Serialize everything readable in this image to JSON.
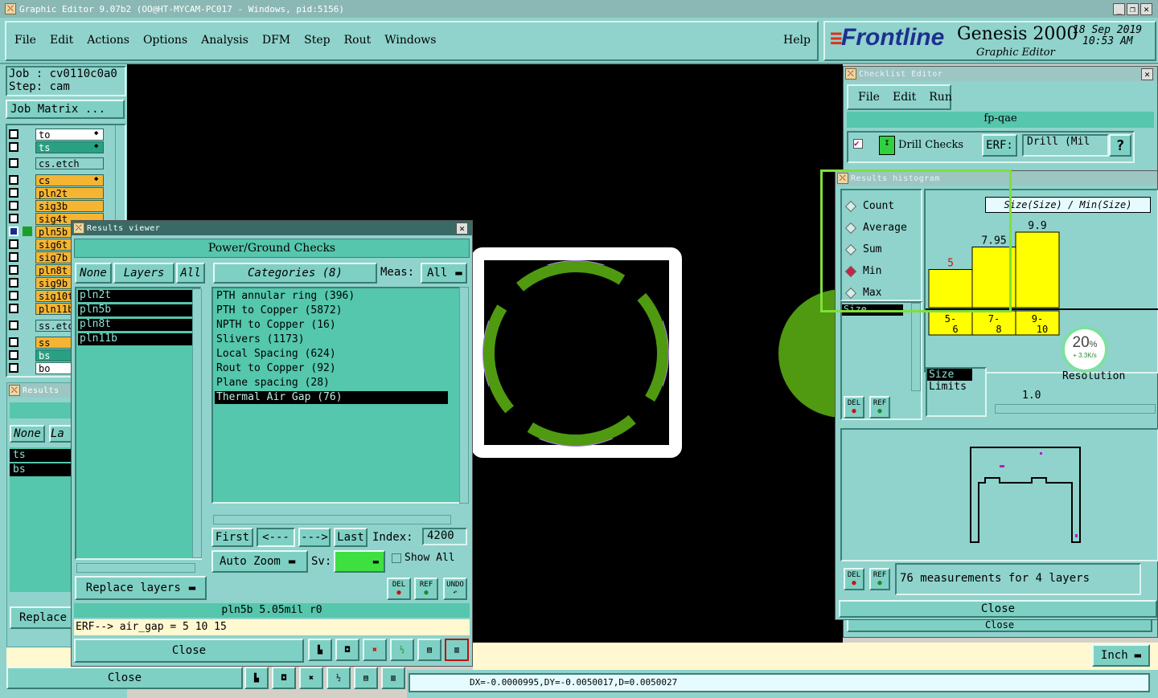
{
  "window": {
    "title": "Graphic Editor 9.07b2 (OO@HT-MYCAM-PC017 - Windows, pid:5156)"
  },
  "menu": {
    "items": [
      "File",
      "Edit",
      "Actions",
      "Options",
      "Analysis",
      "DFM",
      "Step",
      "Rout",
      "Windows"
    ],
    "help": "Help"
  },
  "brand": {
    "logo": "Frontline",
    "product": "Genesis 2000",
    "subtitle": "Graphic Editor",
    "date": "18 Sep 2019",
    "time": "10:53 AM"
  },
  "job": {
    "job": "Job : cv0110c0a0",
    "step": "Step: cam",
    "matrix_button": "Job Matrix ..."
  },
  "layers": [
    {
      "name": "to",
      "color": "#ffffff",
      "board": true
    },
    {
      "name": "ts",
      "color": "#2aa082",
      "board": true
    },
    {
      "name": "cs.etch",
      "color": "#8fd3cc",
      "board": false
    },
    {
      "name": "cs",
      "color": "#f5b432",
      "board": true
    },
    {
      "name": "pln2t",
      "color": "#f5b432",
      "board": false
    },
    {
      "name": "sig3b",
      "color": "#f5b432",
      "board": false
    },
    {
      "name": "sig4t",
      "color": "#f5b432",
      "board": false
    },
    {
      "name": "pln5b",
      "color": "#f5b432",
      "board": false
    },
    {
      "name": "sig6t",
      "color": "#f5b432",
      "board": false
    },
    {
      "name": "sig7b",
      "color": "#f5b432",
      "board": false
    },
    {
      "name": "pln8t",
      "color": "#f5b432",
      "board": false
    },
    {
      "name": "sig9b",
      "color": "#f5b432",
      "board": false
    },
    {
      "name": "sig10t",
      "color": "#f5b432",
      "board": false
    },
    {
      "name": "pln11b",
      "color": "#f5b432",
      "board": false
    },
    {
      "name": "ss.etch",
      "color": "#8fd3cc",
      "board": false
    },
    {
      "name": "ss",
      "color": "#f5b432",
      "board": false
    },
    {
      "name": "bs",
      "color": "#2aa082",
      "board": false
    },
    {
      "name": "bo",
      "color": "#ffffff",
      "board": false
    }
  ],
  "results_back": {
    "title": "Results",
    "none": "None",
    "layers": "La",
    "items": [
      "ts",
      "bs"
    ],
    "replace": "Replace",
    "close": "Close"
  },
  "results_viewer": {
    "title": "Results viewer",
    "header": "Power/Ground Checks",
    "none": "None",
    "layers": "Layers",
    "all": "All",
    "layer_items": [
      "pln2t",
      "pln5b",
      "pln8t",
      "pln11b"
    ],
    "categories_label": "Categories (8)",
    "meas_label": "Meas:",
    "meas_value": "All",
    "categories": [
      "PTH annular ring (396)",
      "PTH to Copper (5872)",
      "NPTH to Copper (16)",
      "Slivers (1173)",
      "Local Spacing (624)",
      "Rout to Copper (92)",
      "Plane spacing (28)",
      "Thermal Air Gap (76)"
    ],
    "first": "First",
    "prev": "<---",
    "next": "--->",
    "last": "Last",
    "index_label": "Index:",
    "index_value": "4200",
    "auto_zoom": "Auto Zoom",
    "sv_label": "Sv:",
    "show_all": "Show All",
    "replace_layers": "Replace layers",
    "del": "DEL",
    "ref": "REF",
    "undo": "UNDO",
    "status": "pln5b 5.05mil  r0",
    "erf_line": "ERF--> air_gap = 5 10 15",
    "close": "Close"
  },
  "checklist": {
    "title": "Checklist Editor",
    "menu": [
      "File",
      "Edit",
      "Run"
    ],
    "name": "fp-qae",
    "check": "Drill Checks",
    "erf_label": "ERF:",
    "erf_value": "Drill (Mil",
    "help": "?",
    "close": "Close"
  },
  "histogram": {
    "title": "Results histogram",
    "options": [
      "Count",
      "Average",
      "Sum",
      "Min",
      "Max"
    ],
    "selected": "Min",
    "size_label": "Size",
    "chart_title": "Size(Size) / Min(Size)",
    "resolution_label": "Resolution",
    "resolution_value": "1.0",
    "size_limits": [
      "Size",
      "Limits"
    ],
    "measurements": "76 measurements for 4 layers",
    "close": "Close",
    "del": "DEL",
    "ref": "REF"
  },
  "chart_data": {
    "type": "bar",
    "categories": [
      "5-6",
      "7-8",
      "9-10"
    ],
    "values": [
      5,
      7.95,
      9.9
    ],
    "value_labels": [
      "5",
      "7.95",
      "9.9"
    ],
    "title": "Size(Size) / Min(Size)",
    "bar_color": "#ffff00",
    "highlight_label_color": "#d01010"
  },
  "overlay": {
    "percent": "20",
    "percent_sign": "%",
    "speed": "+ 3.3K/s"
  },
  "statusbar": {
    "coords": "DX=-0.0000995,DY=-0.0050017,D=0.0050027",
    "units": "Inch"
  },
  "colors": {
    "teal": "#8fd3cc",
    "canvas": "#000000",
    "pad_green": "#4f9a10",
    "violet": "#b07cf0"
  }
}
